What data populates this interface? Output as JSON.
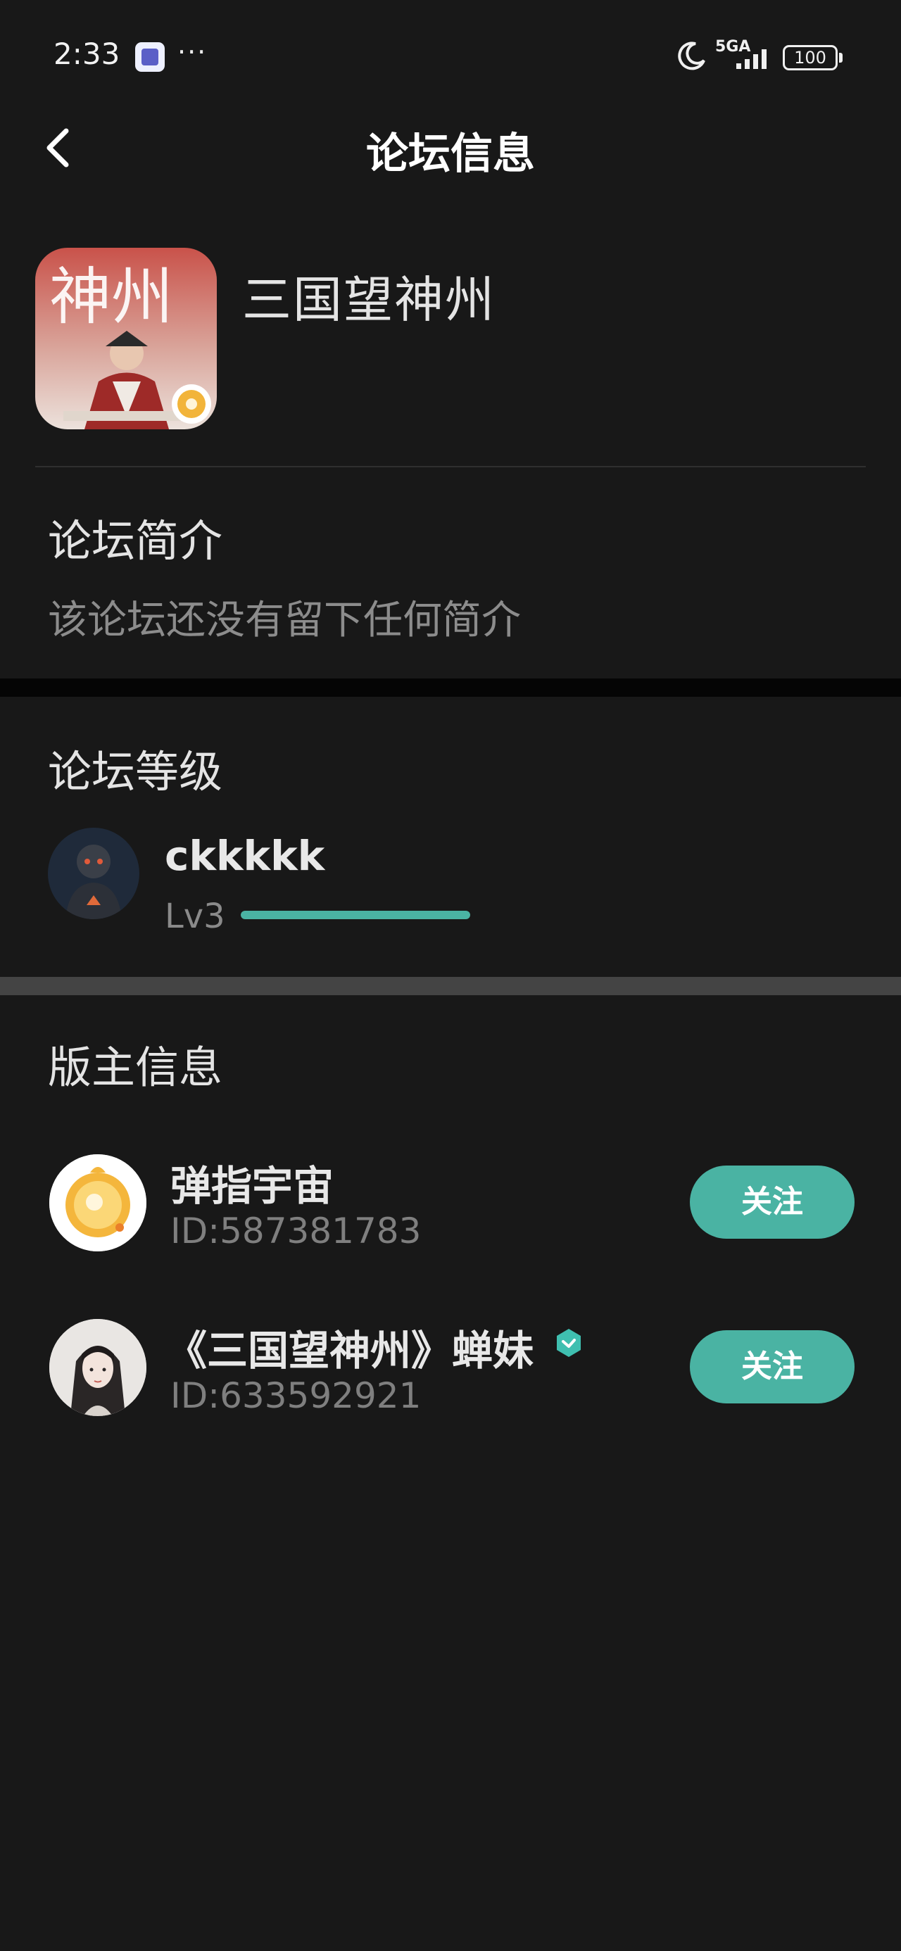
{
  "status_bar": {
    "time": "2:33",
    "more": "···",
    "network": "5GA",
    "battery": "100",
    "icons": [
      "teams-icon",
      "moon-icon",
      "signal-icon",
      "battery-icon"
    ]
  },
  "header": {
    "title": "论坛信息",
    "back_icon": "chevron-left-icon"
  },
  "forum": {
    "name": "三国望神州",
    "icon_text": "神州"
  },
  "intro": {
    "title": "论坛简介",
    "text": "该论坛还没有留下任何简介"
  },
  "level": {
    "title": "论坛等级",
    "username": "ckkkkk",
    "level_label": "Lv3",
    "progress": 1.0,
    "bar_color": "#4ab3a3"
  },
  "moderators": {
    "title": "版主信息",
    "items": [
      {
        "name": "弹指宇宙",
        "id": "ID:587381783",
        "follow_label": "关注",
        "verified": false
      },
      {
        "name": "《三国望神州》蝉妹",
        "id": "ID:633592921",
        "follow_label": "关注",
        "verified": true
      }
    ]
  },
  "colors": {
    "background": "#181818",
    "accent": "#4ab3a3",
    "secondary_text": "#8c8c8c"
  }
}
